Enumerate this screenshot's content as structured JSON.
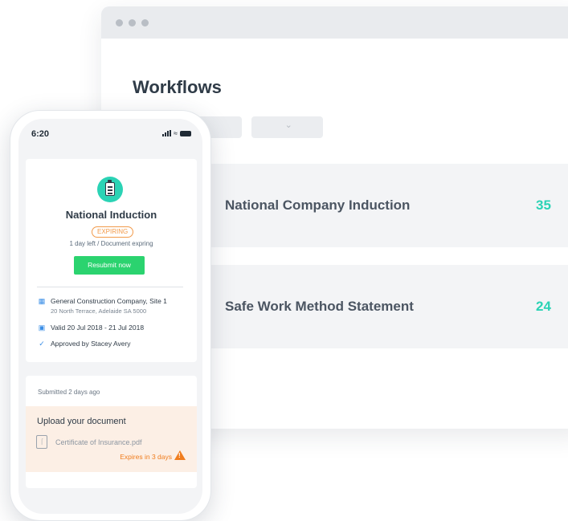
{
  "browser": {
    "title": "Workflows",
    "workflows": [
      {
        "name": "National Company Induction",
        "count": "35"
      },
      {
        "name": "Safe Work Method Statement",
        "count": "24"
      }
    ]
  },
  "phone": {
    "status_time": "6:20",
    "card": {
      "title": "National Induction",
      "badge": "EXPIRING",
      "note": "1 day left / Document expring",
      "button": "Resubmit now",
      "company": "General Construction Company, Site 1",
      "address": "20 North Terrace, Adelaide SA 5000",
      "validity": "Valid 20 Jul 2018  -  21 Jul 2018",
      "approval": "Approved by Stacey Avery"
    },
    "submission": {
      "submitted": "Submitted 2 days ago",
      "upload_title": "Upload your document",
      "file_name": "Certificate of Insurance.pdf",
      "expires": "Expires in 3 days"
    }
  },
  "colors": {
    "accent": "#2bd3b5",
    "button": "#2bd36f",
    "warning": "#f07d1e"
  }
}
